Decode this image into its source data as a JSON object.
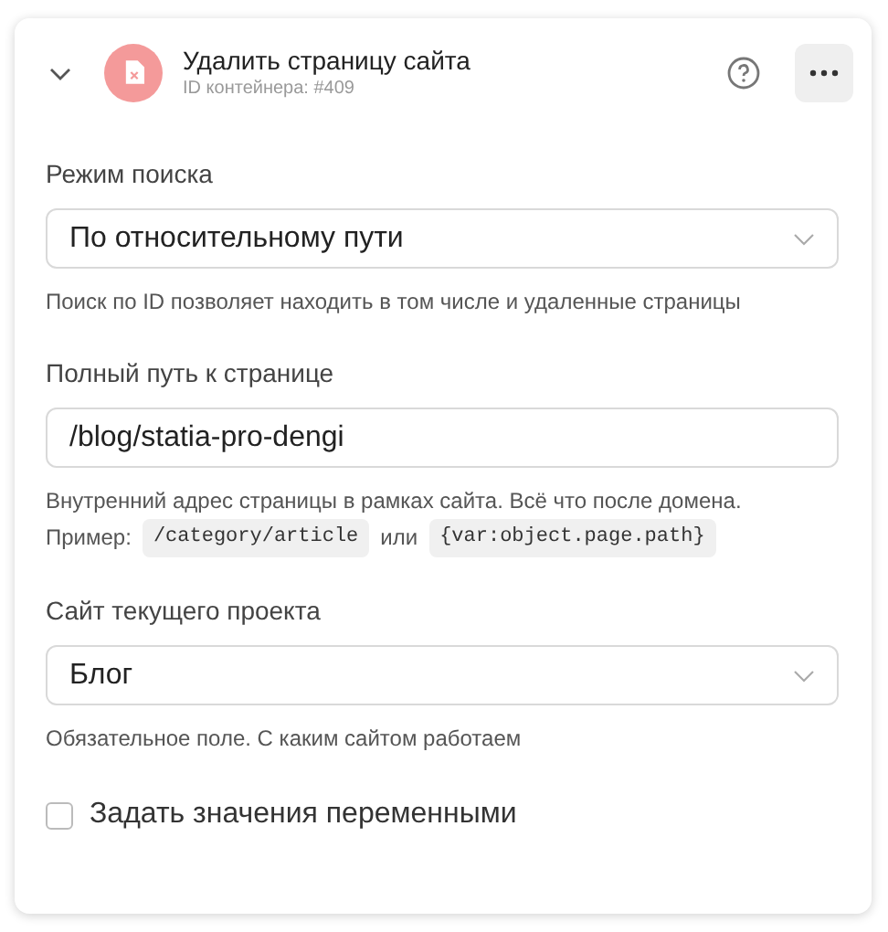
{
  "header": {
    "title": "Удалить страницу сайта",
    "subtitle": "ID контейнера: #409",
    "expanded": true
  },
  "fields": [
    {
      "kind": "select",
      "label": "Режим поиска",
      "value": "По относительному пути",
      "hint": [
        [
          {
            "kind": "text",
            "text": "Поиск по ID позволяет находить в том числе и удаленные страницы"
          }
        ]
      ]
    },
    {
      "kind": "input",
      "label": "Полный путь к странице",
      "value": "/blog/statia-pro-dengi",
      "hint": [
        [
          {
            "kind": "text",
            "text": "Внутренний адрес страницы в рамках сайта. Всё что после домена."
          }
        ],
        [
          {
            "kind": "text",
            "text": "Пример:"
          },
          {
            "kind": "code",
            "text": "/category/article"
          },
          {
            "kind": "text",
            "text": "или"
          },
          {
            "kind": "code",
            "text": "{var:object.page.path}"
          }
        ]
      ]
    },
    {
      "kind": "select",
      "label": "Сайт текущего проекта",
      "value": "Блог",
      "hint": [
        [
          {
            "kind": "text",
            "text": "Обязательное поле. С каким сайтом работаем"
          }
        ]
      ]
    },
    {
      "kind": "checkbox",
      "label": "Задать значения переменными",
      "checked": false
    }
  ]
}
